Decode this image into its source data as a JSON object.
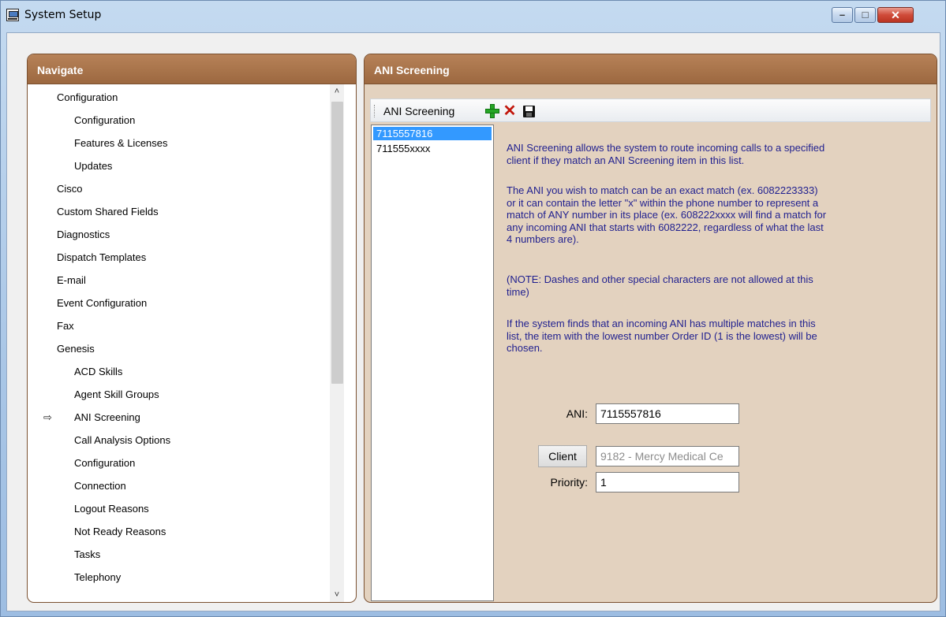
{
  "window": {
    "title": "System Setup",
    "controls": {
      "minimize_icon": "minimize-icon",
      "maximize_icon": "maximize-icon",
      "close_icon": "close-icon"
    }
  },
  "navigate": {
    "header": "Navigate",
    "items": [
      {
        "label": "Configuration",
        "level": 1
      },
      {
        "label": "Configuration",
        "level": 2
      },
      {
        "label": "Features & Licenses",
        "level": 2
      },
      {
        "label": "Updates",
        "level": 2
      },
      {
        "label": "Cisco",
        "level": 1
      },
      {
        "label": "Custom Shared Fields",
        "level": 1
      },
      {
        "label": "Diagnostics",
        "level": 1
      },
      {
        "label": "Dispatch Templates",
        "level": 1
      },
      {
        "label": "E-mail",
        "level": 1
      },
      {
        "label": "Event Configuration",
        "level": 1
      },
      {
        "label": "Fax",
        "level": 1
      },
      {
        "label": "Genesis",
        "level": 1
      },
      {
        "label": "ACD Skills",
        "level": 2
      },
      {
        "label": "Agent Skill Groups",
        "level": 2
      },
      {
        "label": "ANI Screening",
        "level": 2,
        "current": true
      },
      {
        "label": "Call Analysis Options",
        "level": 2
      },
      {
        "label": "Configuration",
        "level": 2
      },
      {
        "label": "Connection",
        "level": 2
      },
      {
        "label": "Logout Reasons",
        "level": 2
      },
      {
        "label": "Not Ready Reasons",
        "level": 2
      },
      {
        "label": "Tasks",
        "level": 2
      },
      {
        "label": "Telephony",
        "level": 2
      }
    ]
  },
  "ani_panel": {
    "header": "ANI Screening",
    "toolbar": {
      "label": "ANI Screening",
      "add_icon": "add-icon",
      "delete_icon": "delete-icon",
      "save_icon": "save-icon"
    },
    "entries": [
      {
        "value": "7115557816",
        "selected": true
      },
      {
        "value": "711555xxxx",
        "selected": false
      }
    ],
    "description": {
      "p1_l1": "ANI Screening allows the system to route incoming calls to a specified",
      "p1_l2": "client if they match an ANI Screening item in this list.",
      "p2_l1": "The ANI you wish to match can be an exact match (ex. 6082223333)",
      "p2_l2": "or it can contain the letter \"x\" within the phone number to represent a",
      "p2_l3": "match of ANY number in its place (ex. 608222xxxx will find a match for",
      "p2_l4": "any incoming ANI that starts with 6082222, regardless of what the last",
      "p2_l5": "4 numbers are).",
      "p3_l1": "(NOTE: Dashes and other special characters are not allowed at this",
      "p3_l2": "time)",
      "p4_l1": "If the system finds that an incoming ANI has multiple matches in this",
      "p4_l2": "list, the item with the lowest number Order ID (1 is the lowest) will be",
      "p4_l3": "chosen."
    },
    "form": {
      "ani_label": "ANI:",
      "ani_value": "7115557816",
      "client_button": "Client",
      "client_value": "9182 - Mercy Medical Ce",
      "priority_label": "Priority:",
      "priority_value": "1"
    }
  },
  "colors": {
    "panel_header": "#a06d44",
    "panel_body": "#e3d2bf",
    "description_text": "#1f1f8f",
    "selection": "#3399ff"
  }
}
